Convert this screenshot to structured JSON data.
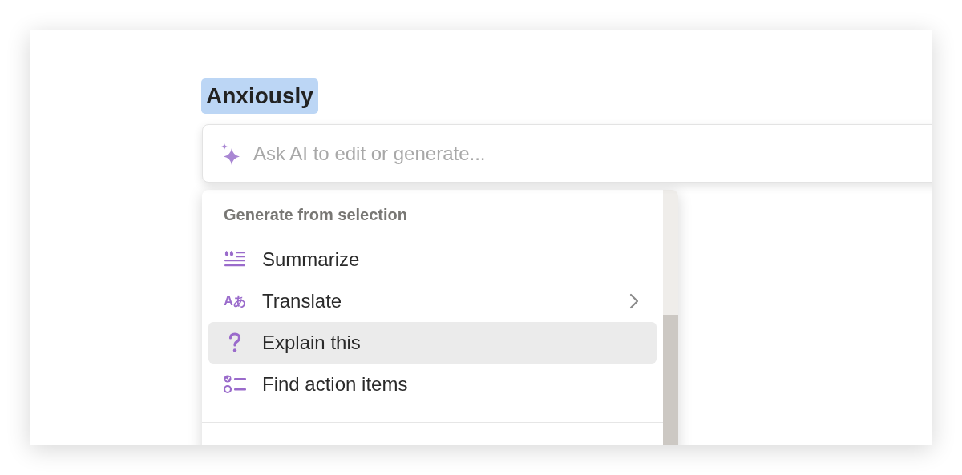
{
  "selection": {
    "text": "Anxiously",
    "selected": true
  },
  "ai_input": {
    "placeholder": "Ask AI to edit or generate..."
  },
  "menu": {
    "section_title": "Generate from selection",
    "items": [
      {
        "kind": "summarize",
        "label": "Summarize",
        "selected": false,
        "submenu": false
      },
      {
        "kind": "translate",
        "label": "Translate",
        "icon_text": "Aあ",
        "selected": false,
        "submenu": true
      },
      {
        "kind": "explain",
        "label": "Explain this",
        "selected": true,
        "submenu": false
      },
      {
        "kind": "actions",
        "label": "Find action items",
        "selected": false,
        "submenu": false
      }
    ]
  }
}
